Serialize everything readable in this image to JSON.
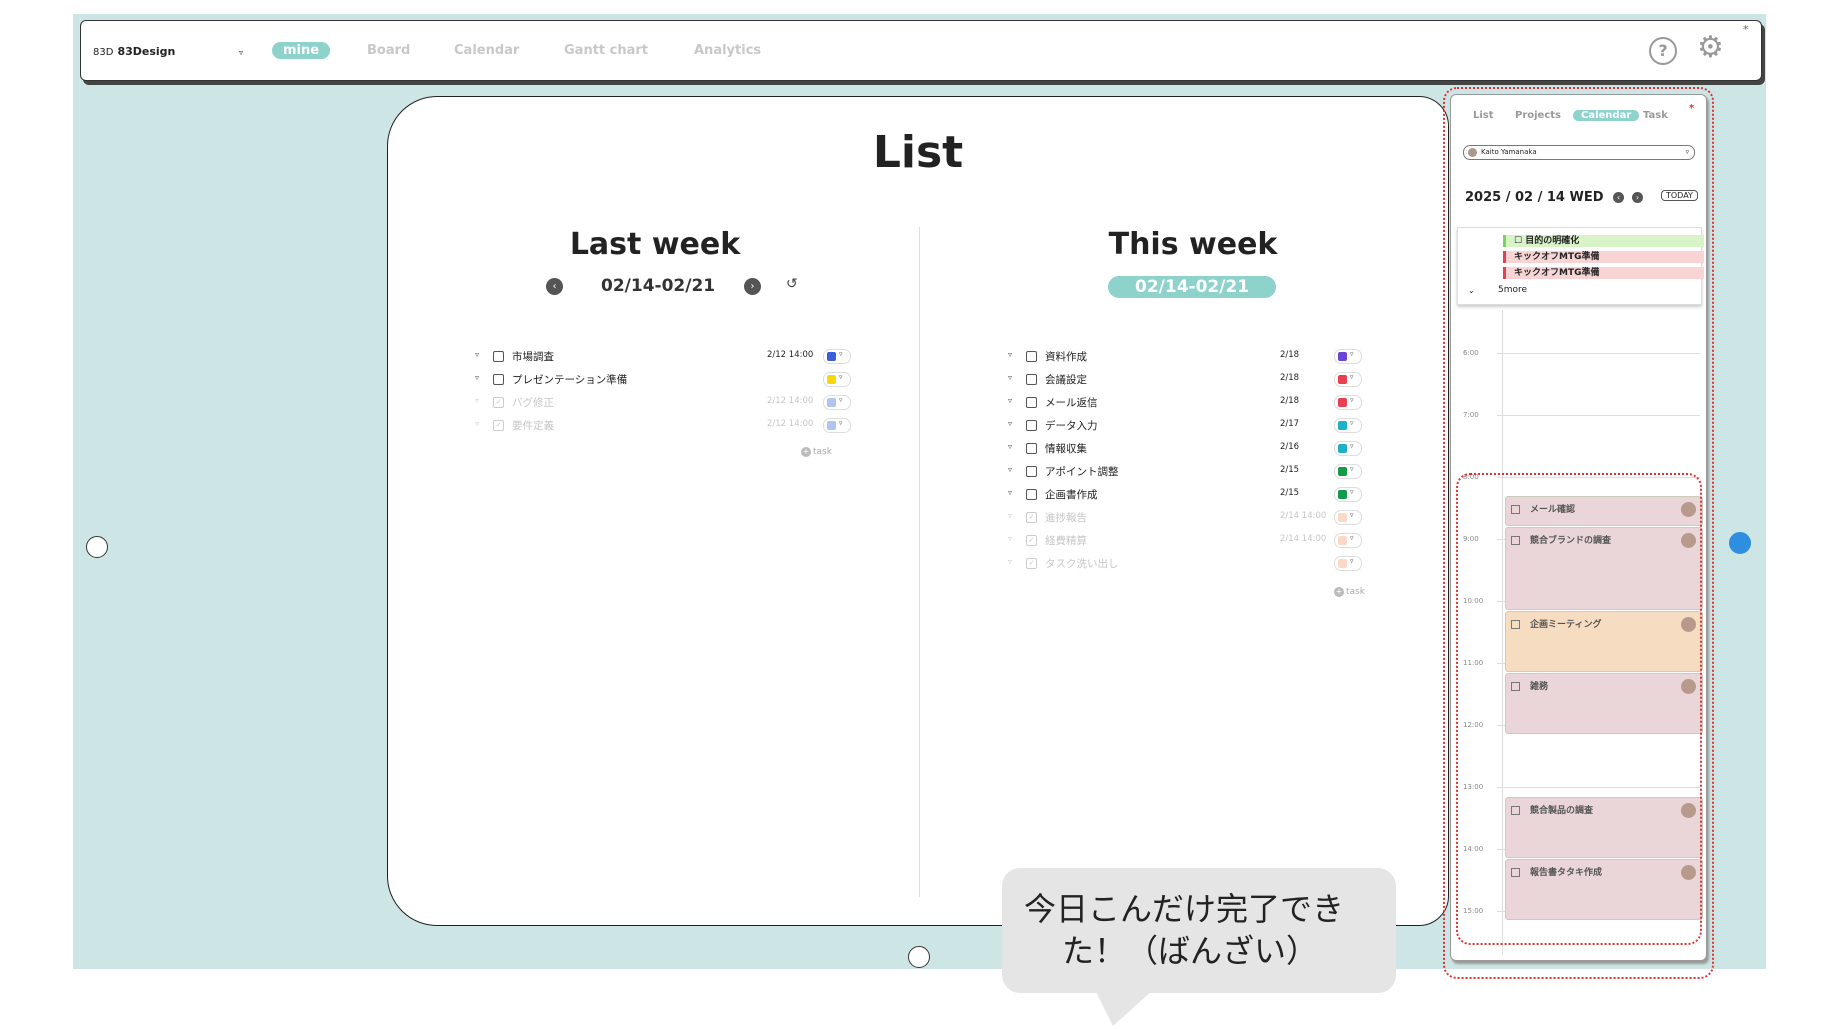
{
  "colors": {
    "accent": "#8ed2cc",
    "canvas": "#cde5e4",
    "outline": "#e03030"
  },
  "header": {
    "logo_mark": "83D",
    "app_name": "83Design",
    "dropdown": "▿",
    "tabs": [
      {
        "label": "mine",
        "active": true
      },
      {
        "label": "Board"
      },
      {
        "label": "Calendar"
      },
      {
        "label": "Gantt chart"
      },
      {
        "label": "Analytics"
      }
    ],
    "help_icon": "?",
    "settings_icon": "⚙",
    "star": "*"
  },
  "main": {
    "title": "List",
    "last_week": {
      "title": "Last week",
      "range": "02/14-02/21",
      "undo": "↺",
      "tasks": [
        {
          "name": "市場調査",
          "date": "2/12 14:00",
          "color": "#3a5fd9",
          "done": false
        },
        {
          "name": "プレゼンテーション準備",
          "date": "",
          "color": "#f5d80e",
          "done": false
        },
        {
          "name": "バグ修正",
          "date": "2/12 14:00",
          "color": "#aec6ef",
          "done": true
        },
        {
          "name": "要件定義",
          "date": "2/12 14:00",
          "color": "#aec6ef",
          "done": true
        }
      ],
      "add": "task"
    },
    "this_week": {
      "title": "This week",
      "range": "02/14-02/21",
      "tasks": [
        {
          "name": "資料作成",
          "date": "2/18",
          "color": "#6a45d6",
          "done": false
        },
        {
          "name": "会議設定",
          "date": "2/18",
          "color": "#e84050",
          "done": false
        },
        {
          "name": "メール返信",
          "date": "2/18",
          "color": "#e84050",
          "done": false
        },
        {
          "name": "データ入力",
          "date": "2/17",
          "color": "#1fb0c8",
          "done": false
        },
        {
          "name": "情報収集",
          "date": "2/16",
          "color": "#1fb0c8",
          "done": false
        },
        {
          "name": "アポイント調整",
          "date": "2/15",
          "color": "#139a4a",
          "done": false
        },
        {
          "name": "企画書作成",
          "date": "2/15",
          "color": "#139a4a",
          "done": false
        },
        {
          "name": "進捗報告",
          "date": "2/14 14:00",
          "color": "#fbd9c6",
          "done": true
        },
        {
          "name": "経費精算",
          "date": "2/14 14:00",
          "color": "#fbd9c6",
          "done": true
        },
        {
          "name": "タスク洗い出し",
          "date": "",
          "color": "#fbd9c6",
          "done": true
        }
      ],
      "add": "task"
    }
  },
  "side": {
    "tabs": [
      {
        "label": "List"
      },
      {
        "label": "Projects"
      },
      {
        "label": "Calendar",
        "active": true
      },
      {
        "label": "Task"
      }
    ],
    "star": "*",
    "user": "Kaito Yamanaka",
    "date": "2025 / 02 / 14 WED",
    "today": "TODAY",
    "allday": [
      {
        "name": "目的の明確化",
        "bg": "#d8f3c8",
        "bar": "#7bd35a"
      },
      {
        "name": "キックオフMTG準備",
        "bg": "#f8d4d4",
        "bar": "#e84050"
      },
      {
        "name": "キックオフMTG準備",
        "bg": "#f8d4d4",
        "bar": "#e84050"
      }
    ],
    "more": "5more",
    "hours": [
      "6:00",
      "7:00",
      "8:00",
      "9:00",
      "10:00",
      "11:00",
      "12:00",
      "13:00",
      "14:00",
      "15:00"
    ],
    "events": [
      {
        "name": "メール確認",
        "start": 8.3,
        "end": 8.75,
        "bg": "#ead6d9"
      },
      {
        "name": "競合ブランドの調査",
        "start": 8.8,
        "end": 10.1,
        "bg": "#ead6d9"
      },
      {
        "name": "企画ミーティング",
        "start": 10.15,
        "end": 11.1,
        "bg": "#f6dcc0"
      },
      {
        "name": "雑務",
        "start": 11.15,
        "end": 12.1,
        "bg": "#ead6d9"
      },
      {
        "name": "競合製品の調査",
        "start": 13.15,
        "end": 14.1,
        "bg": "#ead6d9"
      },
      {
        "name": "報告書タタキ作成",
        "start": 14.15,
        "end": 15.1,
        "bg": "#ead6d9"
      }
    ]
  },
  "bubble": {
    "line1": "今日こんだけ完了でき",
    "line2": "た！（ばんざい）"
  }
}
